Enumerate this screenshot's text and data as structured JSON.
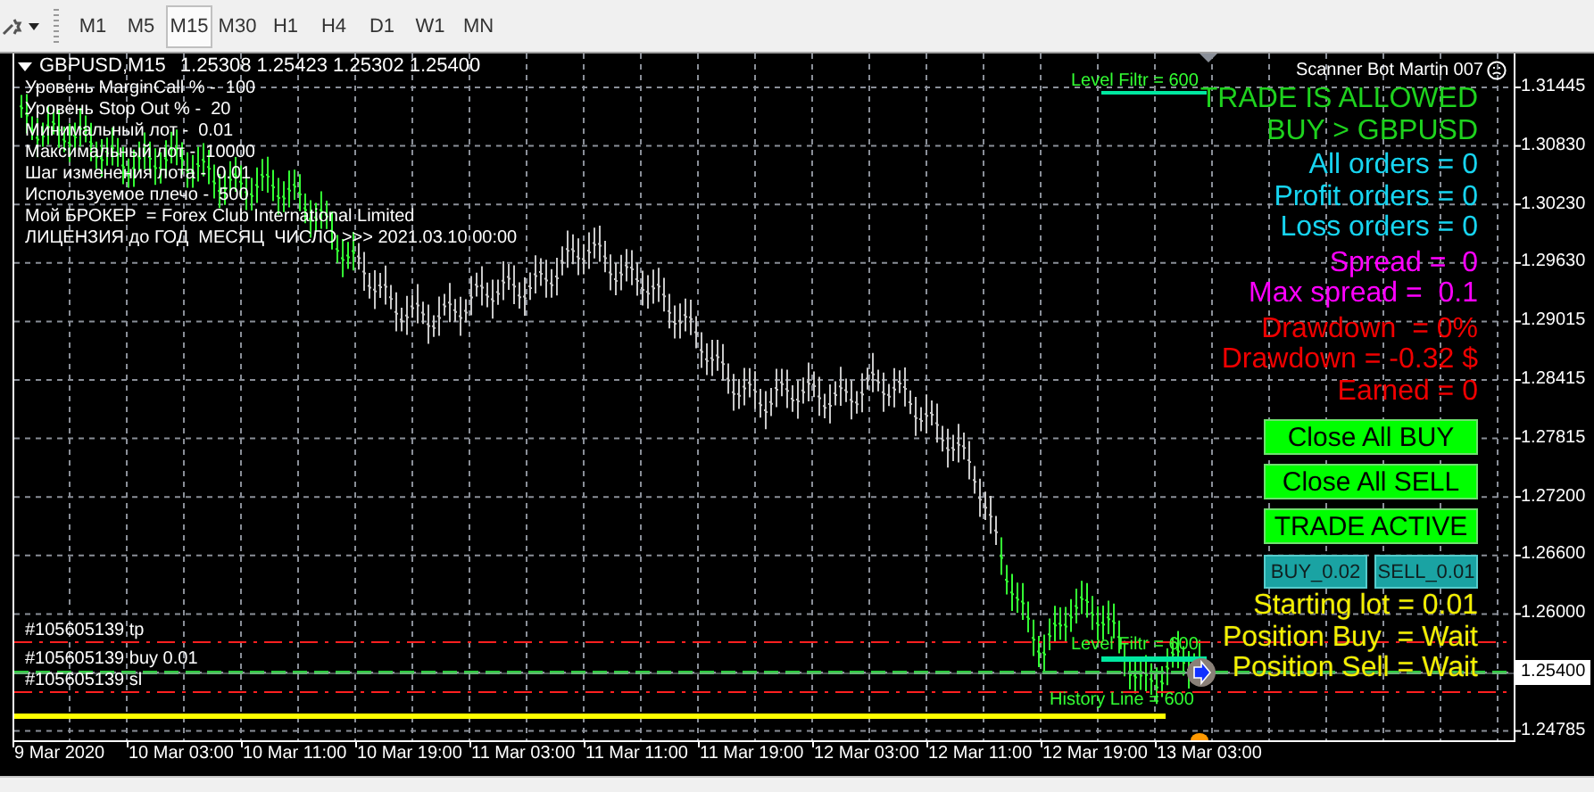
{
  "toolbar": {
    "timeframes": [
      {
        "label": "M1",
        "selected": false
      },
      {
        "label": "M5",
        "selected": false
      },
      {
        "label": "M15",
        "selected": true
      },
      {
        "label": "M30",
        "selected": false
      },
      {
        "label": "H1",
        "selected": false
      },
      {
        "label": "H4",
        "selected": false
      },
      {
        "label": "D1",
        "selected": false
      },
      {
        "label": "W1",
        "selected": false
      },
      {
        "label": "MN",
        "selected": false
      }
    ]
  },
  "chart": {
    "header": {
      "symbol": "GBPUSD,M15",
      "quotes": "1.25308 1.25423 1.25302 1.25400"
    },
    "info_lines": [
      "Уровень MarginCall % -  100",
      "Уровень Stop Out % -  20",
      "Минимальный лот -  0.01",
      "Максимальный лот -  10000",
      "Шаг изменения лота -  0.01",
      "Используемое плечо -  500",
      "Мой БРОКЕР  = Forex Club International Limited",
      "ЛИЦЕНЗИЯ до ГОД  МЕСЯЦ  ЧИСЛО >>> 2021.03.10 00:00"
    ],
    "price_ticks": [
      {
        "label": "1.31445",
        "current": false
      },
      {
        "label": "1.30830",
        "current": false
      },
      {
        "label": "1.30230",
        "current": false
      },
      {
        "label": "1.29630",
        "current": false
      },
      {
        "label": "1.29015",
        "current": false
      },
      {
        "label": "1.28415",
        "current": false
      },
      {
        "label": "1.27815",
        "current": false
      },
      {
        "label": "1.27200",
        "current": false
      },
      {
        "label": "1.26600",
        "current": false
      },
      {
        "label": "1.26000",
        "current": false
      },
      {
        "label": "1.25400",
        "current": true
      },
      {
        "label": "1.24785",
        "current": false
      }
    ],
    "time_ticks": [
      "9 Mar 2020",
      "10 Mar 03:00",
      "10 Mar 11:00",
      "10 Mar 19:00",
      "11 Mar 03:00",
      "11 Mar 11:00",
      "11 Mar 19:00",
      "12 Mar 03:00",
      "12 Mar 11:00",
      "12 Mar 19:00",
      "13 Mar 03:00"
    ],
    "order_lines": [
      {
        "kind": "tp",
        "label": "#105605139 tp"
      },
      {
        "kind": "buy",
        "label": "#105605139 buy 0.01"
      },
      {
        "kind": "sl",
        "label": "#105605139 sl"
      }
    ],
    "level_filters": [
      "Level Filtr = 600",
      "Level Filtr = 600"
    ],
    "history_line": "History Line = 600"
  },
  "panel": {
    "title": "Scanner Bot Martin 007",
    "status_lines": [
      {
        "kind": "trade",
        "text": "TRADE IS ALLOWED"
      },
      {
        "kind": "trade",
        "text": "BUY > GBPUSD"
      },
      {
        "kind": "orders",
        "text": "All orders = 0"
      },
      {
        "kind": "orders",
        "text": "Profit orders = 0"
      },
      {
        "kind": "orders",
        "text": "Loss orders = 0"
      },
      {
        "kind": "spread",
        "text": "Spread =  0"
      },
      {
        "kind": "spread",
        "text": "Max spread =  0.1"
      },
      {
        "kind": "drawdown",
        "text": "Drawdown  = 0%"
      },
      {
        "kind": "drawdown",
        "text": "Drawdown = -0.32 $"
      },
      {
        "kind": "drawdown",
        "text": "Earned = 0"
      }
    ],
    "buttons": [
      "Close All BUY",
      "Close All SELL",
      "TRADE ACTIVE"
    ],
    "lot_buttons": [
      "BUY_0.02",
      "SELL_0.01"
    ],
    "position_lines": [
      "Starting lot = 0.01",
      "Position Buy  = Wait",
      "Position Sell = Wait"
    ]
  }
}
